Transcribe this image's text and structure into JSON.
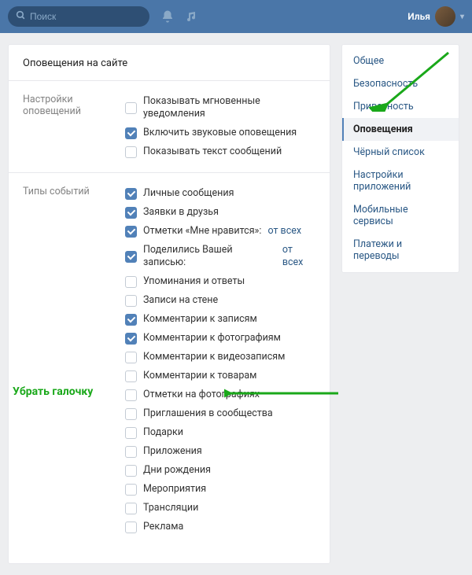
{
  "topbar": {
    "search_placeholder": "Поиск",
    "user_name": "Илья"
  },
  "panel_title": "Оповещения на сайте",
  "section_notif": {
    "label": "Настройки оповещений",
    "items": [
      {
        "label": "Показывать мгновенные уведомления",
        "checked": false
      },
      {
        "label": "Включить звуковые оповещения",
        "checked": true
      },
      {
        "label": "Показывать текст сообщений",
        "checked": false
      }
    ]
  },
  "section_types": {
    "label": "Типы событий",
    "items": [
      {
        "label": "Личные сообщения",
        "checked": true
      },
      {
        "label": "Заявки в друзья",
        "checked": true
      },
      {
        "label": "Отметки «Мне нравится»:",
        "checked": true,
        "link": "от всех"
      },
      {
        "label": "Поделились Вашей записью:",
        "checked": true,
        "link": "от всех"
      },
      {
        "label": "Упоминания и ответы",
        "checked": false
      },
      {
        "label": "Записи на стене",
        "checked": false
      },
      {
        "label": "Комментарии к записям",
        "checked": true
      },
      {
        "label": "Комментарии к фотографиям",
        "checked": true
      },
      {
        "label": "Комментарии к видеозаписям",
        "checked": false
      },
      {
        "label": "Комментарии к товарам",
        "checked": false
      },
      {
        "label": "Отметки на фотографиях",
        "checked": false
      },
      {
        "label": "Приглашения в сообщества",
        "checked": false
      },
      {
        "label": "Подарки",
        "checked": false
      },
      {
        "label": "Приложения",
        "checked": false
      },
      {
        "label": "Дни рождения",
        "checked": false
      },
      {
        "label": "Мероприятия",
        "checked": false
      },
      {
        "label": "Трансляции",
        "checked": false
      },
      {
        "label": "Реклама",
        "checked": false
      }
    ]
  },
  "sidebar": {
    "items": [
      {
        "label": "Общее"
      },
      {
        "label": "Безопасность"
      },
      {
        "label": "Приватность"
      },
      {
        "label": "Оповещения",
        "active": true
      },
      {
        "label": "Чёрный список"
      },
      {
        "label": "Настройки приложений"
      },
      {
        "label": "Мобильные сервисы"
      },
      {
        "label": "Платежи и переводы"
      }
    ]
  },
  "annotation": {
    "text": "Убрать галочку"
  }
}
